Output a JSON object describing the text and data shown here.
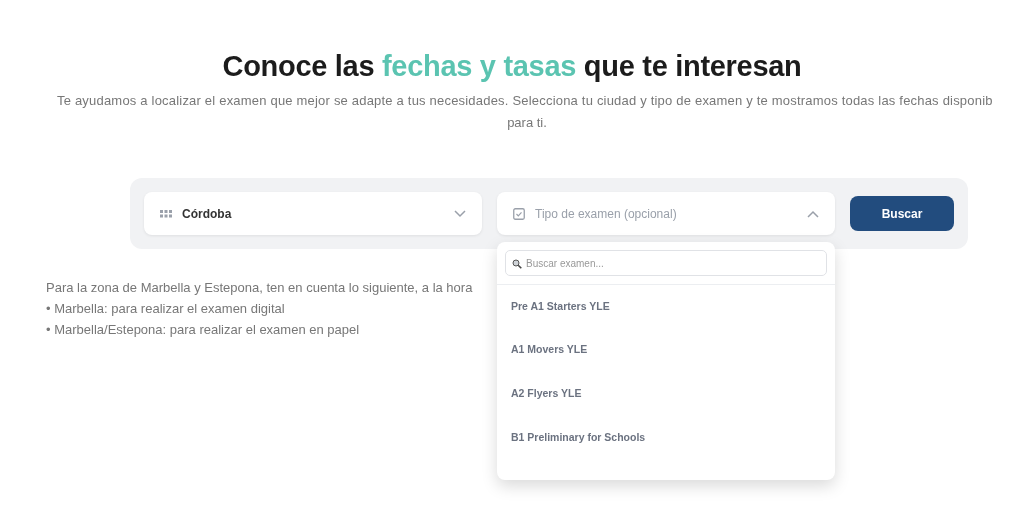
{
  "heading": {
    "before": "Conoce las ",
    "highlight": "fechas y tasas",
    "after": " que te interesan"
  },
  "intro": [
    "Te ayudamos a localizar el examen que mejor se adapte a tus necesidades. Selecciona tu ciudad y tipo de examen y te mostramos todas las fechas disponib",
    "para ti."
  ],
  "city_select": {
    "value": "Córdoba",
    "expanded": false
  },
  "exam_select": {
    "placeholder": "Tipo de examen (opcional)",
    "expanded": true,
    "search": {
      "placeholder": "Buscar examen..."
    },
    "options": [
      {
        "label": "Pre A1 Starters YLE"
      },
      {
        "label": "A1 Movers YLE"
      },
      {
        "label": "A2 Flyers YLE"
      },
      {
        "label": "B1 Preliminary for Schools"
      }
    ]
  },
  "search_button": "Buscar",
  "notes": [
    "Para la zona de Marbella y Estepona, ten en cuenta lo siguiente, a la hora",
    "• Marbella: para realizar el examen digital",
    "• Marbella/Estepona: para realizar el examen en papel"
  ]
}
